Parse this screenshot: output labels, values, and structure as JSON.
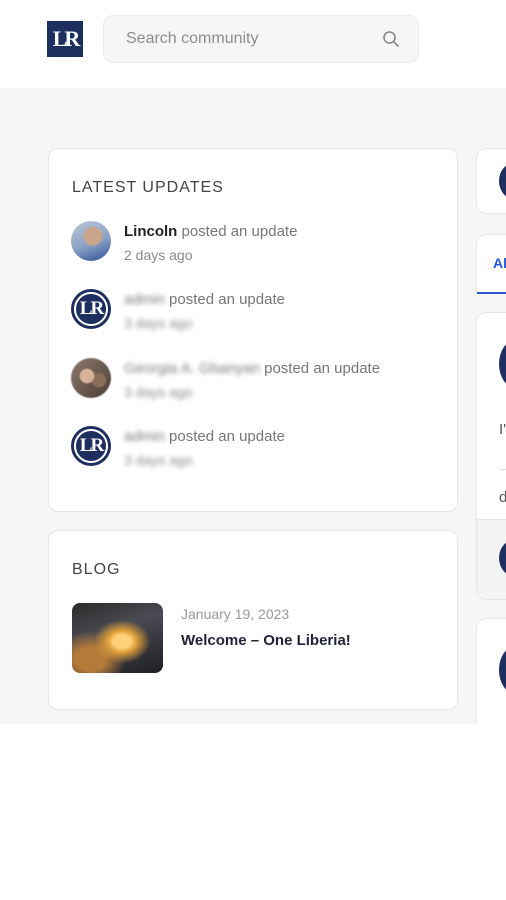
{
  "header": {
    "logo_text": "LR",
    "search": {
      "placeholder": "Search community",
      "value": ""
    }
  },
  "latest_updates": {
    "title": "LATEST UPDATES",
    "items": [
      {
        "name": "Lincoln",
        "action": "posted an update",
        "time": "2 days ago",
        "avatar": "user-photo"
      },
      {
        "name": "admin",
        "action": "posted an update",
        "time": "3 days ago",
        "avatar": "lr-logo"
      },
      {
        "name": "Georgia A. Gbanyan",
        "action": "posted an update",
        "time": "3 days ago",
        "avatar": "user-photo"
      },
      {
        "name": "admin",
        "action": "posted an update",
        "time": "3 days ago",
        "avatar": "lr-logo"
      }
    ]
  },
  "blog": {
    "title": "BLOG",
    "post": {
      "date": "January 19, 2023",
      "title": "Welcome – One Liberia!"
    }
  },
  "feed": {
    "tab_all": "Al",
    "post_text": "I'",
    "post_icon_text": "d"
  },
  "colors": {
    "brand": "#1d2f5e",
    "accent": "#2657d4",
    "background": "#f6f6f6"
  }
}
